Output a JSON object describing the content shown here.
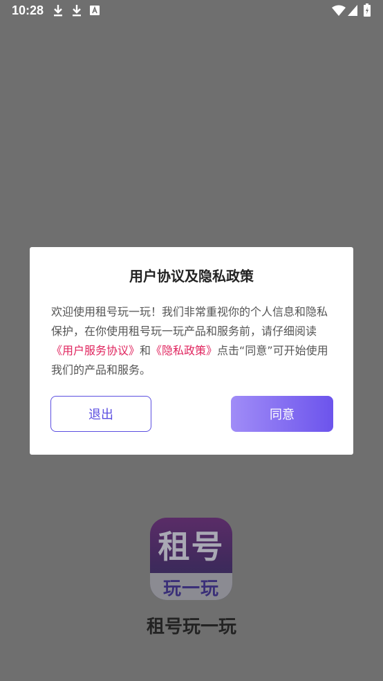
{
  "status_bar": {
    "time": "10:28",
    "left_icons": [
      "download-icon",
      "download-icon",
      "keyboard-a-icon"
    ],
    "right_icons": [
      "wifi-icon",
      "signal-icon",
      "battery-charging-icon"
    ]
  },
  "dialog": {
    "title": "用户协议及隐私政策",
    "body_before": "欢迎使用租号玩一玩！我们非常重视你的个人信息和隐私保护，在你使用租号玩一玩产品和服务前，请仔细阅读",
    "link_terms": "《用户服务协议》",
    "body_and": "和",
    "link_privacy": "《隐私政策》",
    "body_after": "点击“同意”可开始使用我们的产品和服务。",
    "exit_label": "退出",
    "agree_label": "同意"
  },
  "app": {
    "logo_top_text": "租号",
    "logo_bottom_text": "玩一玩",
    "name": "租号玩一玩"
  },
  "colors": {
    "link": "#e0245e",
    "accent_start": "#a08cf7",
    "accent_end": "#6c54ec",
    "overlay": "#6f6f6f"
  }
}
